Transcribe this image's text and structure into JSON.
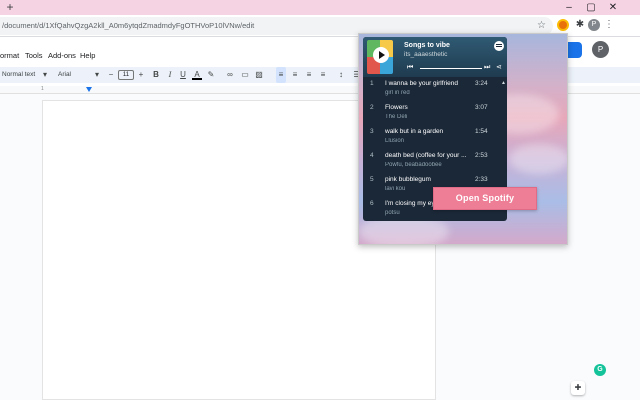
{
  "browser": {
    "new_tab_label": "+",
    "url": "/document/d/1XfQahvQzgA2kll_A0m6ytqdZmadmdyFgOTHVoP10lVNw/edit",
    "window_controls": {
      "minimize": "–",
      "maximize": "▢",
      "close": "✕"
    },
    "profile_initial": "P"
  },
  "docs": {
    "menu": [
      "ormat",
      "Tools",
      "Add-ons",
      "Help"
    ],
    "toolbar": {
      "style": "Normal text",
      "font": "Arial",
      "size": "11",
      "minus": "−",
      "plus": "+"
    },
    "ruler_ticks": [
      "1",
      "1"
    ],
    "profile_initial": "P",
    "grammarly_label": "G"
  },
  "spotify": {
    "playlist_title": "Songs to vibe",
    "playlist_owner": "its_aaaesthetic",
    "open_button": "Open Spotify",
    "tracks": [
      {
        "num": "1",
        "name": "I wanna be your girlfriend",
        "artist": "girl in red",
        "duration": "3:24"
      },
      {
        "num": "2",
        "name": "Flowers",
        "artist": "The Deli",
        "duration": "3:07"
      },
      {
        "num": "3",
        "name": "walk but in a garden",
        "artist": "Llusion",
        "duration": "1:54"
      },
      {
        "num": "4",
        "name": "death bed (coffee for your ...",
        "artist": "Powfu, beabadoobee",
        "duration": "2:53"
      },
      {
        "num": "5",
        "name": "pink bubblegum",
        "artist": "lavi kou",
        "duration": "2:33"
      },
      {
        "num": "6",
        "name": "I'm closing my eyes",
        "artist": "potsu",
        "duration": ""
      }
    ]
  }
}
